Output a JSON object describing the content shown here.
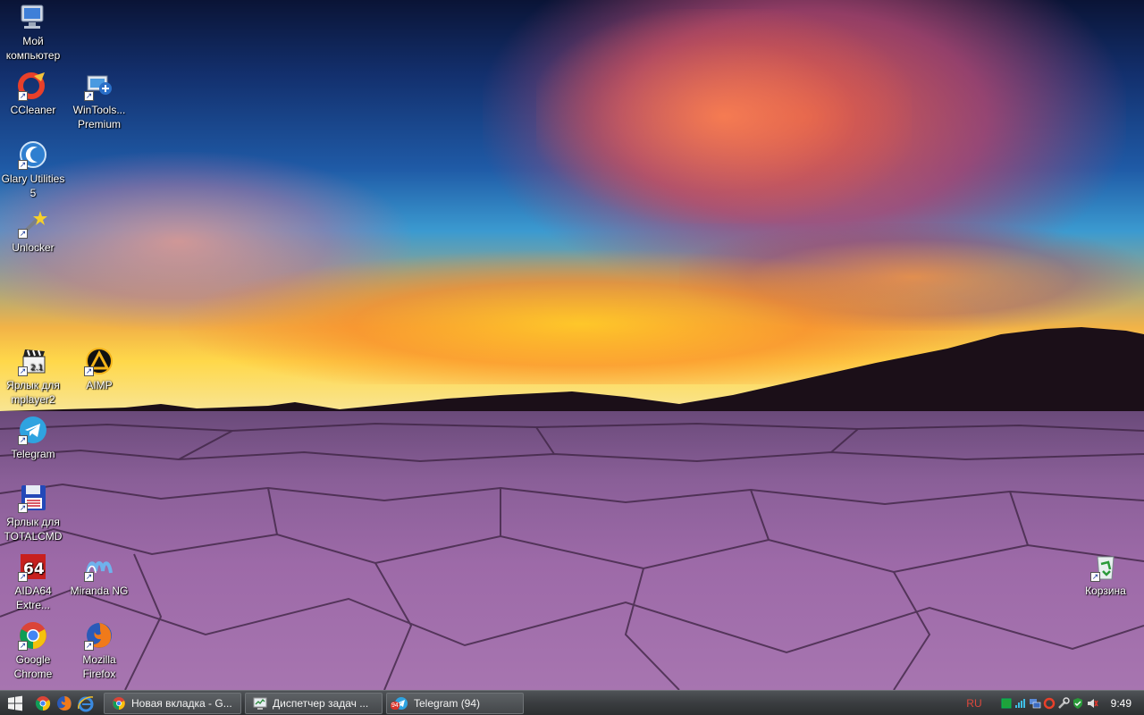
{
  "desktop": {
    "icons": [
      {
        "id": "my-computer",
        "label": "Мой компьютер"
      },
      {
        "id": "ccleaner",
        "label": "CCleaner"
      },
      {
        "id": "wintools",
        "label": "WinTools... Premium"
      },
      {
        "id": "glary",
        "label": "Glary Utilities 5"
      },
      {
        "id": "unlocker",
        "label": "Unlocker"
      },
      {
        "id": "mplayer",
        "label": "Ярлык для mplayer2"
      },
      {
        "id": "aimp",
        "label": "AIMP"
      },
      {
        "id": "telegram",
        "label": "Telegram"
      },
      {
        "id": "totalcmd",
        "label": "Ярлык для TOTALCMD"
      },
      {
        "id": "aida64",
        "label": "AIDA64 Extre..."
      },
      {
        "id": "miranda",
        "label": "Miranda NG"
      },
      {
        "id": "chrome",
        "label": "Google Chrome"
      },
      {
        "id": "firefox",
        "label": "Mozilla Firefox"
      },
      {
        "id": "recycle-bin",
        "label": "Корзина"
      }
    ]
  },
  "taskbar": {
    "quick_launch": [
      "chrome-icon",
      "firefox-icon",
      "ie-icon"
    ],
    "tasks": [
      {
        "label": "Новая вкладка - G...",
        "icon": "chrome-icon"
      },
      {
        "label": "Диспетчер задач ...",
        "icon": "task-manager-icon"
      },
      {
        "label": "Telegram (94)",
        "icon": "telegram-icon",
        "badge": "94"
      }
    ],
    "language": "RU",
    "clock": "9:49"
  }
}
